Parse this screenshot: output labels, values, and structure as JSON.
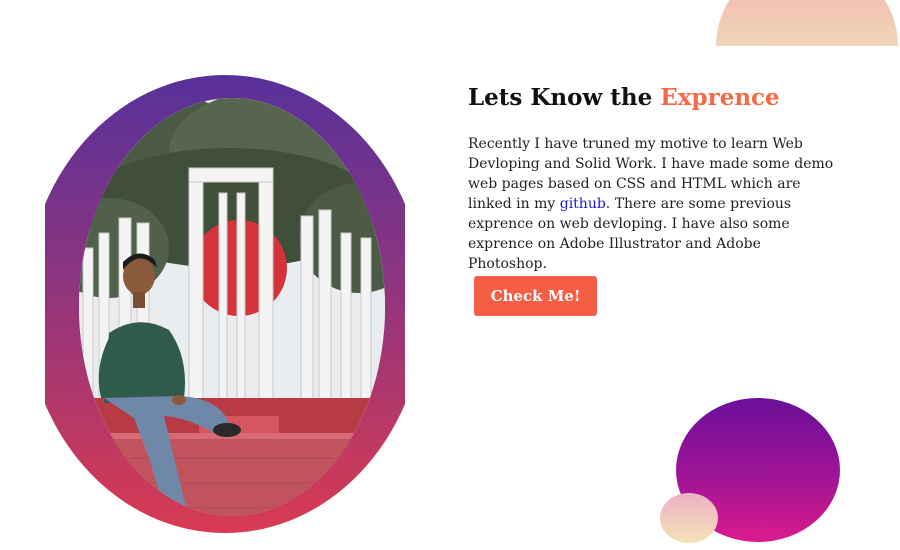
{
  "about": {
    "title_prefix": "Lets Know the",
    "title_accent": "Exprence",
    "description_part1": "Recently I have truned my motive to learn Web Devloping and Solid Work. I have made some demo web pages based on CSS and HTML which are linked in my ",
    "link_text": "github",
    "description_part2": ". There are some previous exprence on web devloping. I have also some exprence on Adobe Illustrator and Adobe Photoshop.",
    "button_label": "Check Me!"
  },
  "colors": {
    "accent": "#f36a49",
    "button": "#f55e45",
    "link": "#1a1ad6",
    "frame_gradient": [
      "#57319a",
      "#8d357f",
      "#d93a52"
    ],
    "blob_gradient": [
      "#6a0f99",
      "#a01496",
      "#dc1b8c"
    ]
  }
}
